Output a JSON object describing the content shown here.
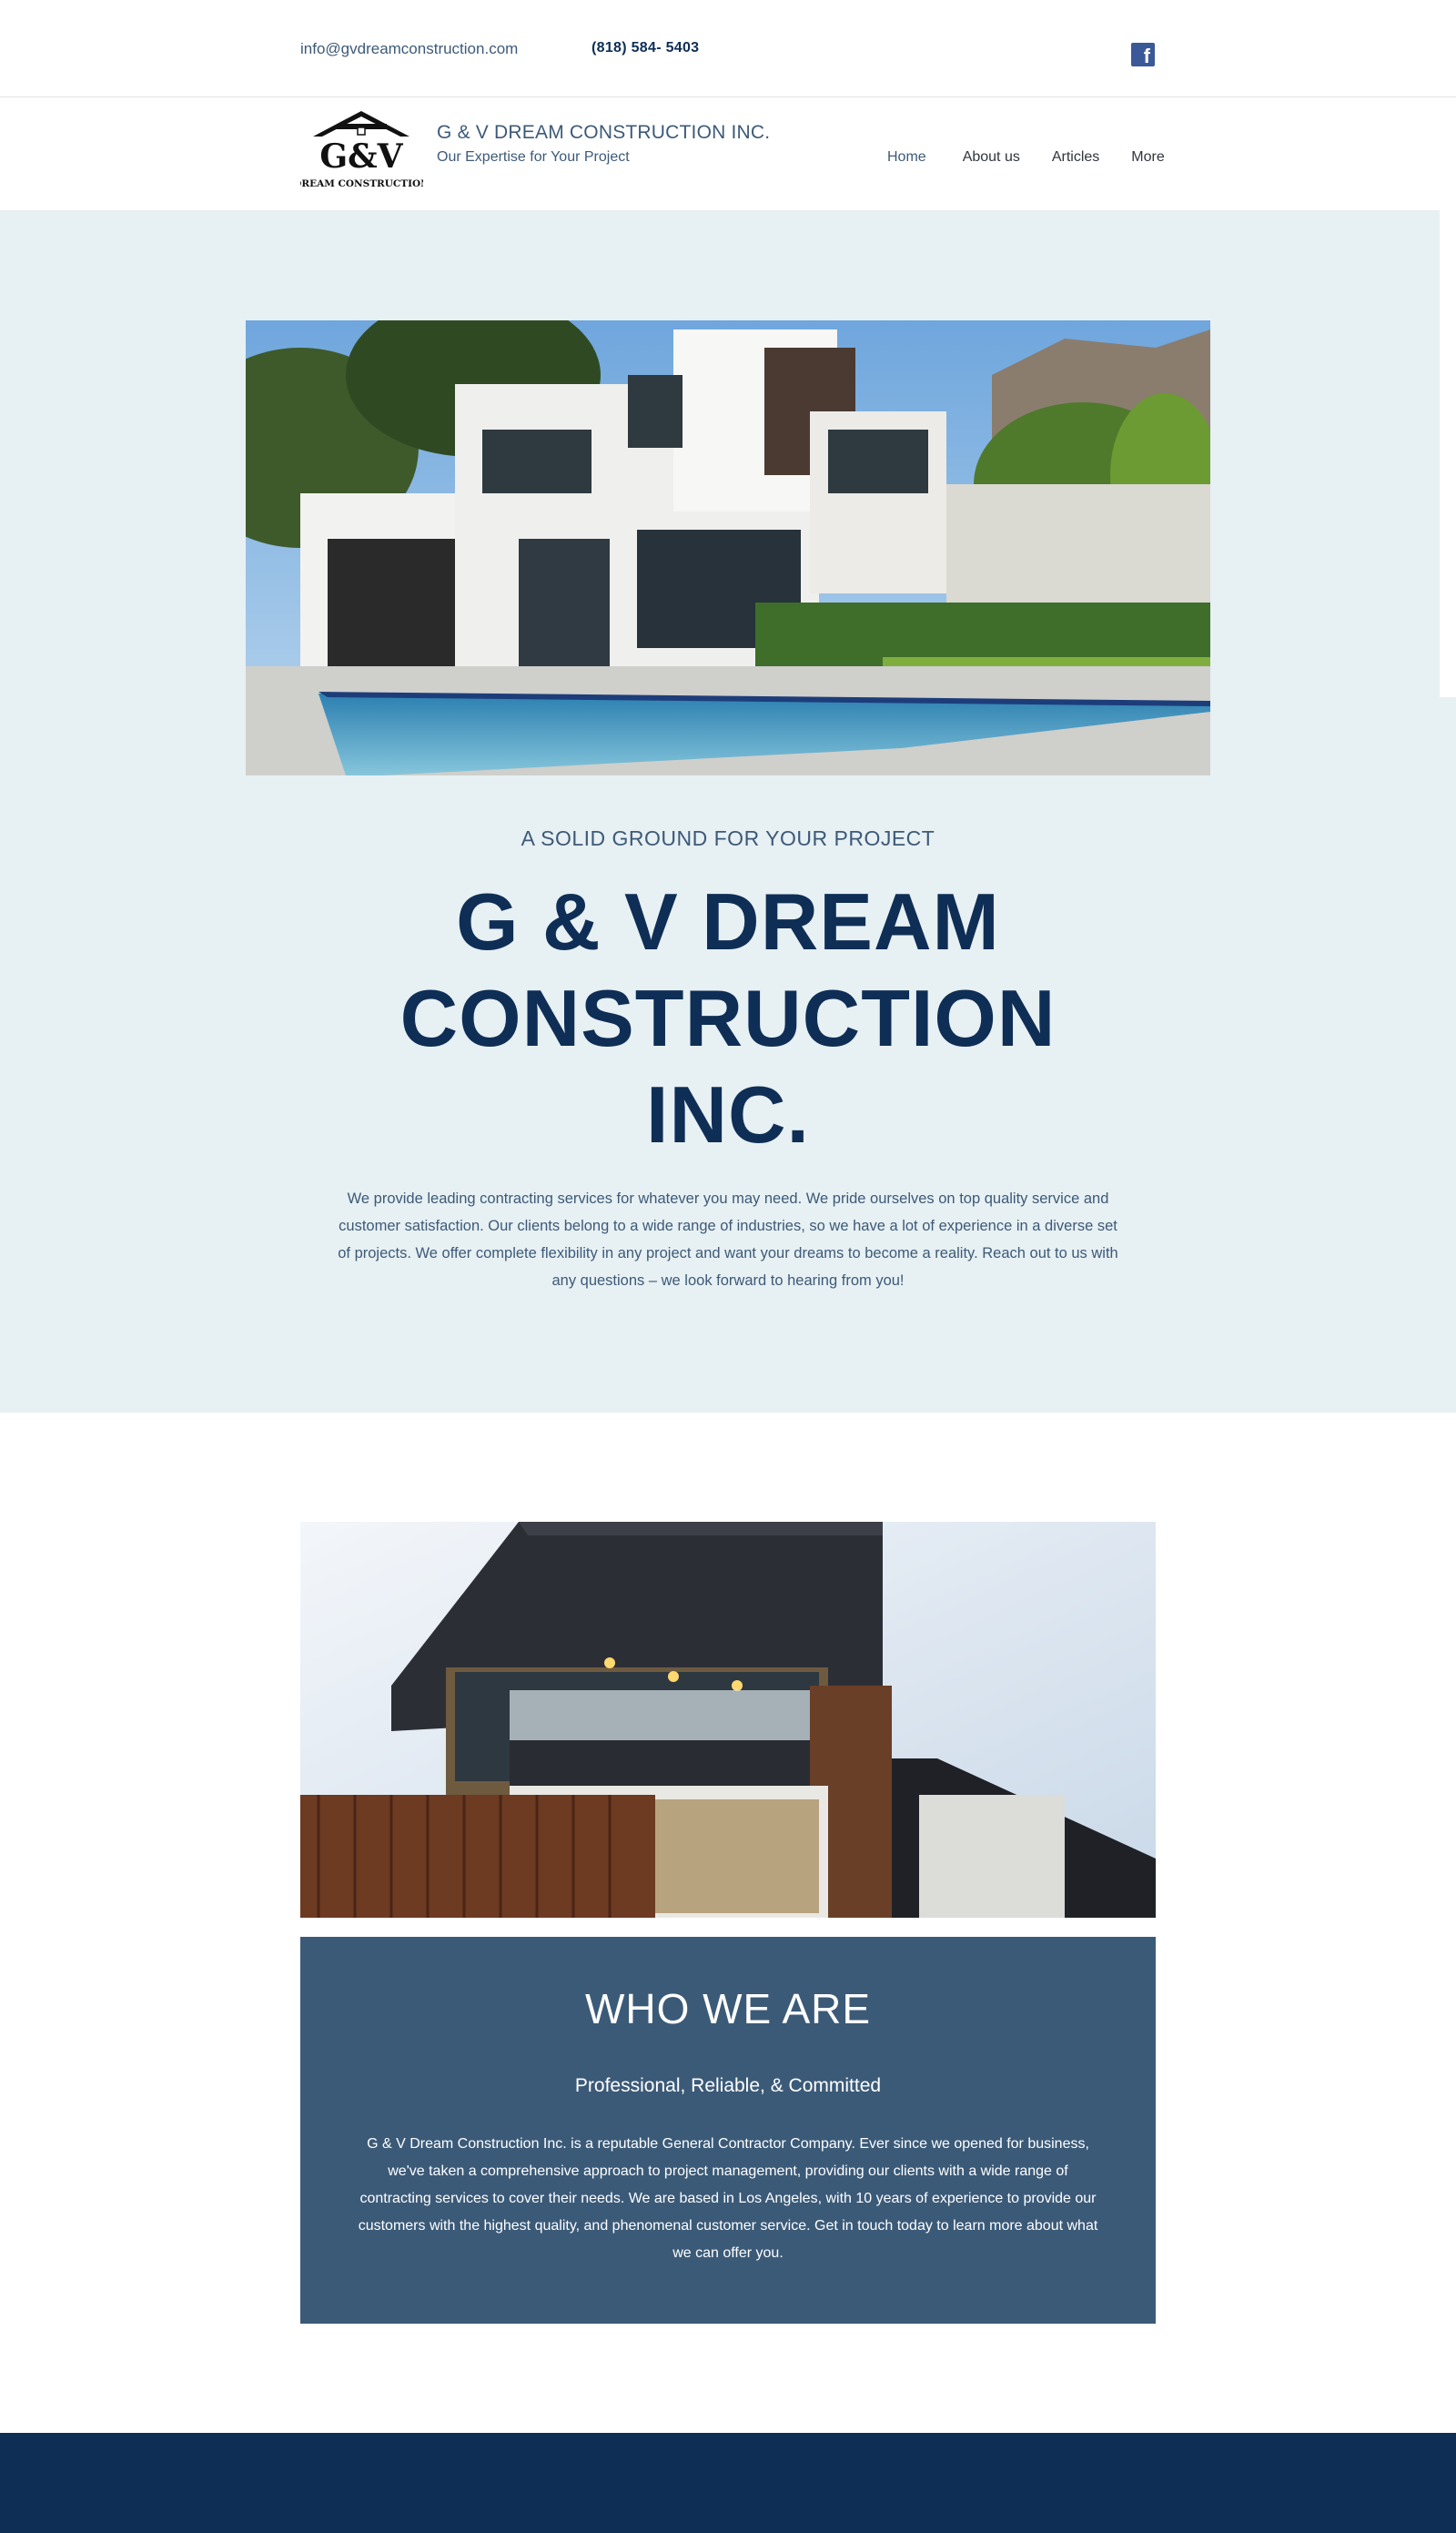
{
  "topbar": {
    "email": "info@gvdreamconstruction.com",
    "phone": "(818) 584- 5403",
    "facebook_icon": "facebook-icon"
  },
  "header": {
    "logo_mark": "G&V",
    "logo_caption": "DREAM CONSTRUCTION",
    "brand_name": "G & V DREAM CONSTRUCTION INC.",
    "tagline": "Our Expertise for Your Project",
    "nav": [
      {
        "label": "Home",
        "active": true
      },
      {
        "label": "About us",
        "active": false
      },
      {
        "label": "Articles",
        "active": false
      },
      {
        "label": "More",
        "active": false
      }
    ]
  },
  "hero": {
    "kicker": "A SOLID GROUND FOR YOUR PROJECT",
    "title_lines": [
      "G & V DREAM",
      "CONSTRUCTION",
      "INC."
    ],
    "text": "We provide leading contracting services for whatever you may need. We pride ourselves on top quality service and customer satisfaction. Our clients belong to a wide range of industries, so we have a lot of experience in a diverse set of projects. We offer complete flexibility in any project and want your dreams to become a reality. Reach out to us with any questions – we look forward to hearing from you!"
  },
  "who": {
    "title": "WHO WE ARE",
    "subtitle": "Professional, Reliable, & Committed",
    "text": "G & V Dream Construction Inc. is a reputable General Contractor Company. Ever since we opened for business, we've taken a comprehensive approach to project management, providing our clients with a wide range of contracting services to cover their needs. We are based in Los Angeles, with 10 years of experience to provide our customers with the highest quality, and phenomenal customer service. Get in touch today to learn more about what we can offer you."
  },
  "colors": {
    "navy": "#0f2e56",
    "slate": "#3b5a78",
    "hero_bg": "#e7f0f3",
    "facebook": "#3b5998"
  }
}
